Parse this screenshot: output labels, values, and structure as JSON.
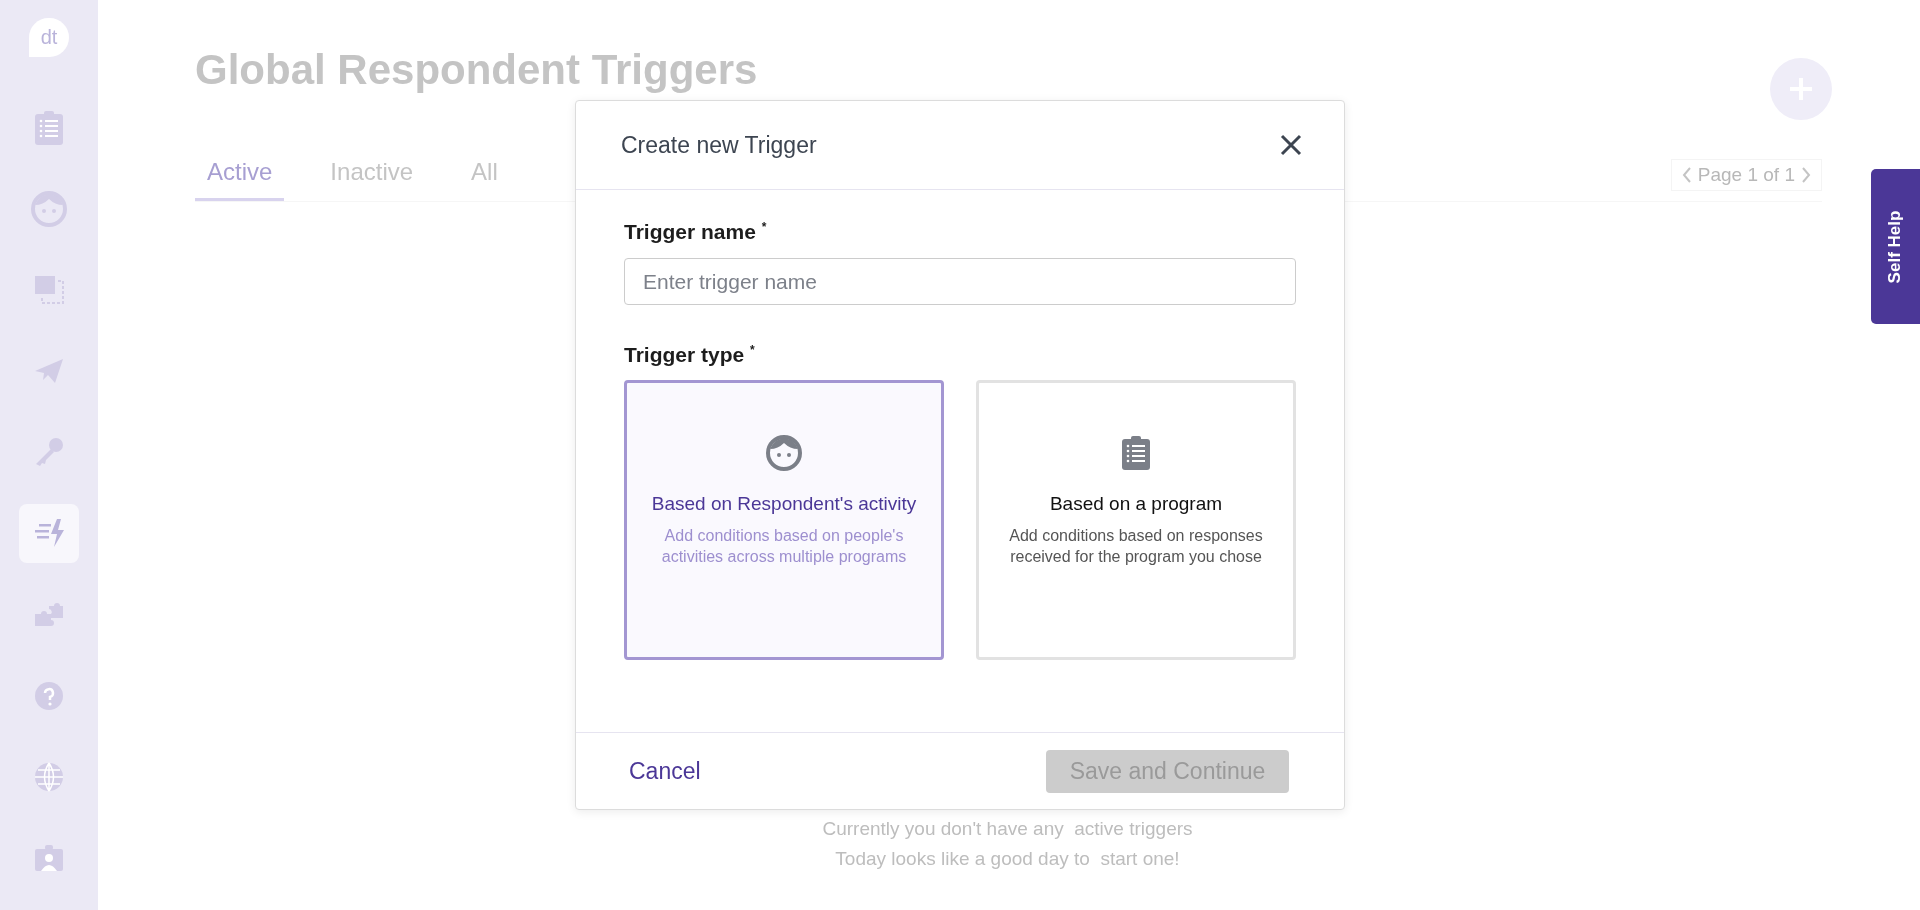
{
  "sidebar": {
    "logo": "dt",
    "items": [
      {
        "kind": "clipboard",
        "selected": false
      },
      {
        "kind": "face",
        "selected": false
      },
      {
        "kind": "screens",
        "selected": false
      },
      {
        "kind": "plane",
        "selected": false
      },
      {
        "kind": "key",
        "selected": false
      },
      {
        "kind": "trigger",
        "selected": true
      },
      {
        "kind": "puzzle",
        "selected": false
      },
      {
        "kind": "help",
        "selected": false
      },
      {
        "kind": "globe",
        "selected": false
      },
      {
        "kind": "badge",
        "selected": false
      }
    ]
  },
  "page": {
    "title": "Global Respondent Triggers",
    "tabs": [
      {
        "label": "Active",
        "selected": true
      },
      {
        "label": "Inactive",
        "selected": false
      },
      {
        "label": "All",
        "selected": false
      }
    ],
    "pagination": "Page 1 of 1",
    "empty_message": [
      "Currently you don't have any  active triggers",
      "Today looks like a good day to  start one!"
    ]
  },
  "self_help": "Self Help",
  "dialog": {
    "title": "Create new Trigger",
    "name_label": "Trigger name",
    "name_placeholder": "Enter trigger name",
    "type_label": "Trigger type",
    "required_mark": "*",
    "types": [
      {
        "kind": "face",
        "title": "Based on Respondent's activity",
        "description": "Add conditions based on people's activities across multiple programs",
        "selected": true
      },
      {
        "kind": "clipboard",
        "title": "Based on a program",
        "description": "Add conditions based on responses received for the program you chose",
        "selected": false
      }
    ],
    "cancel": "Cancel",
    "save": {
      "label": "Save and Continue",
      "disabled": true
    }
  }
}
